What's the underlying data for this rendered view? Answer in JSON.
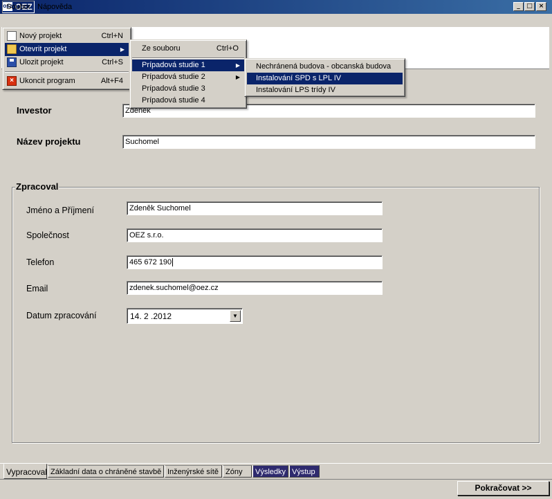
{
  "window": {
    "title": "OEZ",
    "icon_text": "OEZ",
    "minimize": "_",
    "maximize": "□",
    "close": "×"
  },
  "menubar": {
    "file": "Soubor",
    "help": "Nápověda"
  },
  "file_menu": {
    "new": {
      "label": "Nový projekt",
      "shortcut": "Ctrl+N"
    },
    "open": {
      "label": "Otevrit projekt"
    },
    "save": {
      "label": "Ulozit projekt",
      "shortcut": "Ctrl+S"
    },
    "exit": {
      "label": "Ukoncit program",
      "shortcut": "Alt+F4"
    }
  },
  "open_submenu": {
    "from_file": {
      "label": "Ze souboru",
      "shortcut": "Ctrl+O"
    },
    "case_studies": [
      "Prípadová studie 1",
      "Prípadová studie 2",
      "Prípadová studie 3",
      "Prípadová studie 4"
    ]
  },
  "case_study_1_submenu": [
    "Nechránená budova - obcanská budova",
    "Instalování SPD s LPL IV",
    "Instalování LPS trídy IV"
  ],
  "form": {
    "investor_label": "Investor",
    "investor_value": "Zdenek",
    "project_name_label": "Název projektu",
    "project_name_value": "Suchomel"
  },
  "group": {
    "legend": "Zpracoval",
    "name_label": "Jméno a Příjmení",
    "name_value": "Zdeněk Suchomel",
    "company_label": "Společnost",
    "company_value": "OEZ s.r.o.",
    "phone_label": "Telefon",
    "phone_value": "465 672 190",
    "email_label": "Email",
    "email_value": "zdenek.suchomel@oez.cz",
    "date_label": "Datum zpracování",
    "date_value": "14. 2 .2012"
  },
  "tabs": [
    "Vypracoval",
    "Základní data o chráněné stavbě",
    "Inženýrské sítě",
    "Zóny",
    "Výsledky",
    "Výstup"
  ],
  "continue_button": "Pokračovat >>",
  "colors": {
    "highlight": "#0a246a",
    "dark_tab": "#2e2a6e",
    "face": "#d4d0c8"
  }
}
